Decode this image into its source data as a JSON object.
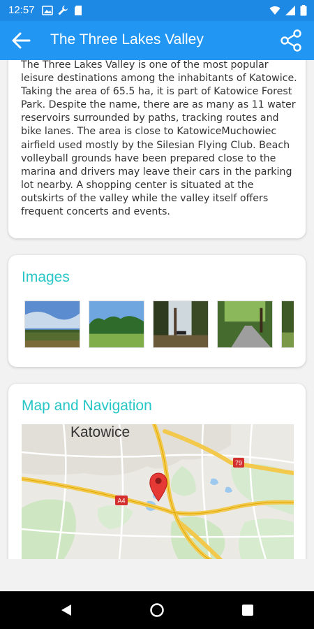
{
  "status_bar": {
    "time": "12:57",
    "icons": [
      "image-icon",
      "wrench-icon",
      "sd-card-icon",
      "wifi-icon",
      "signal-icon",
      "battery-icon"
    ]
  },
  "app_bar": {
    "title": "The Three Lakes Valley",
    "icons": [
      "back-arrow-icon",
      "share-icon"
    ],
    "color": "#2196f3"
  },
  "description": {
    "text": "The Three Lakes Valley is one of the most popular leisure destinations among the inhabitants of Katowice.  Taking the area of 65.5 ha, it is part of Katowice Forest Park. Despite the name, there are as many as 11 water reservoirs surrounded by paths, tracking routes and bike lanes. The area is close to KatowiceMuchowiec airfield used mostly by the Silesian Flying Club. Beach volleyball grounds have been prepared close to the marina and drivers may leave their cars in the parking lot nearby. A shopping center is situated at the outskirts of the valley while the valley itself offers frequent concerts and events."
  },
  "images_section": {
    "title": "Images",
    "accent": "#26c6c6"
  },
  "map_section": {
    "title": "Map and Navigation",
    "city_label": "Katowice",
    "road_labels": [
      "A4",
      "79"
    ],
    "pin_color": "#e53935"
  },
  "nav_bar": {
    "icons": [
      "back-triangle-icon",
      "home-circle-icon",
      "recents-square-icon"
    ]
  }
}
